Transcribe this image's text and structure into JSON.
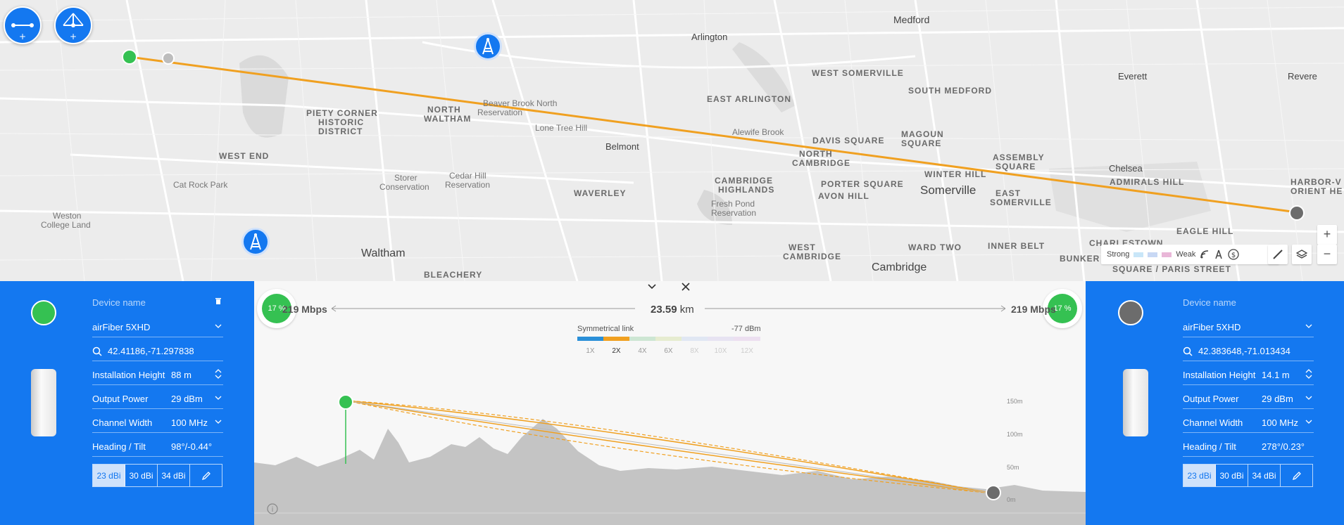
{
  "map": {
    "labels": {
      "medford": "Medford",
      "arlington": "Arlington",
      "west_somerville": "WEST SOMERVILLE",
      "south_medford": "SOUTH MEDFORD",
      "everett": "Everett",
      "revere": "Revere",
      "piety_corner": "PIETY CORNER",
      "historic": "HISTORIC",
      "district": "DISTRICT",
      "north": "NORTH",
      "waltham_n": "WALTHAM",
      "beaver_brook": "Beaver Brook North",
      "reservation": "Reservation",
      "lone_tree": "Lone Tree Hill",
      "east_arlington": "EAST ARLINGTON",
      "alewife": "Alewife Brook",
      "davis": "DAVIS SQUARE",
      "magoun": "MAGOUN",
      "square": "SQUARE",
      "assembly": "ASSEMBLY",
      "assembly_sq": "SQUARE",
      "west_end": "WEST END",
      "belmont": "Belmont",
      "north_cambridge": "NORTH",
      "north_cambridge2": "CAMBRIDGE",
      "chelsea": "Chelsea",
      "cat_rock": "Cat Rock Park",
      "storer": "Storer",
      "conservation": "Conservation",
      "cedar_hill": "Cedar Hill",
      "cedar_res": "Reservation",
      "waverley": "WAVERLEY",
      "cambridge_highlands": "CAMBRIDGE",
      "highlands": "HIGHLANDS",
      "porter": "PORTER SQUARE",
      "winter_hill": "WINTER HILL",
      "somerville": "Somerville",
      "east_somerville": "EAST",
      "east_somerville2": "SOMERVILLE",
      "admirals": "ADMIRALS HILL",
      "harbor_view": "HARBOR-V",
      "orient": "ORIENT HE",
      "weston": "Weston",
      "college_land": "College Land",
      "avon_hill": "AVON HILL",
      "fresh_pond": "Fresh Pond",
      "fresh_res": "Reservation",
      "eagle_hill": "EAGLE HILL",
      "waltham": "Waltham",
      "west_cambridge": "WEST",
      "west_cambridge2": "CAMBRIDGE",
      "ward_two": "WARD TWO",
      "inner_belt": "INNER BELT",
      "charlestown": "CHARLESTOWN",
      "bunker": "BUNKER",
      "bleachery": "BLEACHERY",
      "cambridge": "Cambridge",
      "paris_street": "SQUARE / PARIS STREET"
    },
    "legend": {
      "strong": "Strong",
      "weak": "Weak"
    },
    "zoom_in": "+",
    "zoom_out": "−"
  },
  "left": {
    "device_name_placeholder": "Device name",
    "model": "airFiber 5XHD",
    "coords": "42.41186,-71.297838",
    "installation_height_label": "Installation Height",
    "installation_height": "88 m",
    "output_power_label": "Output Power",
    "output_power": "29 dBm",
    "channel_width_label": "Channel Width",
    "channel_width": "100 MHz",
    "heading_label": "Heading / Tilt",
    "heading": "98°/-0.44°",
    "gains": [
      "23 dBi",
      "30 dBi",
      "34 dBi"
    ]
  },
  "right": {
    "device_name_placeholder": "Device name",
    "model": "airFiber 5XHD",
    "coords": "42.383648,-71.013434",
    "installation_height_label": "Installation Height",
    "installation_height": "14.1 m",
    "output_power_label": "Output Power",
    "output_power": "29 dBm",
    "channel_width_label": "Channel Width",
    "channel_width": "100 MHz",
    "heading_label": "Heading / Tilt",
    "heading": "278°/0.23°",
    "gains": [
      "23 dBi",
      "30 dBi",
      "34 dBi"
    ]
  },
  "link": {
    "left_pct": "17 %",
    "right_pct": "17 %",
    "left_speed": "219 Mbps",
    "right_speed": "219 Mbps",
    "distance_value": "23.59",
    "distance_unit": "km",
    "mode": "Symmetrical link",
    "signal": "-77 dBm",
    "modulations": [
      "1X",
      "2X",
      "4X",
      "6X",
      "8X",
      "10X",
      "12X"
    ],
    "active_modulation": "2X",
    "elevation_ticks": [
      "150m",
      "100m",
      "50m",
      "0m"
    ]
  },
  "colors": {
    "accent": "#1478f0",
    "link": "#f0a020",
    "good": "#35c152"
  }
}
